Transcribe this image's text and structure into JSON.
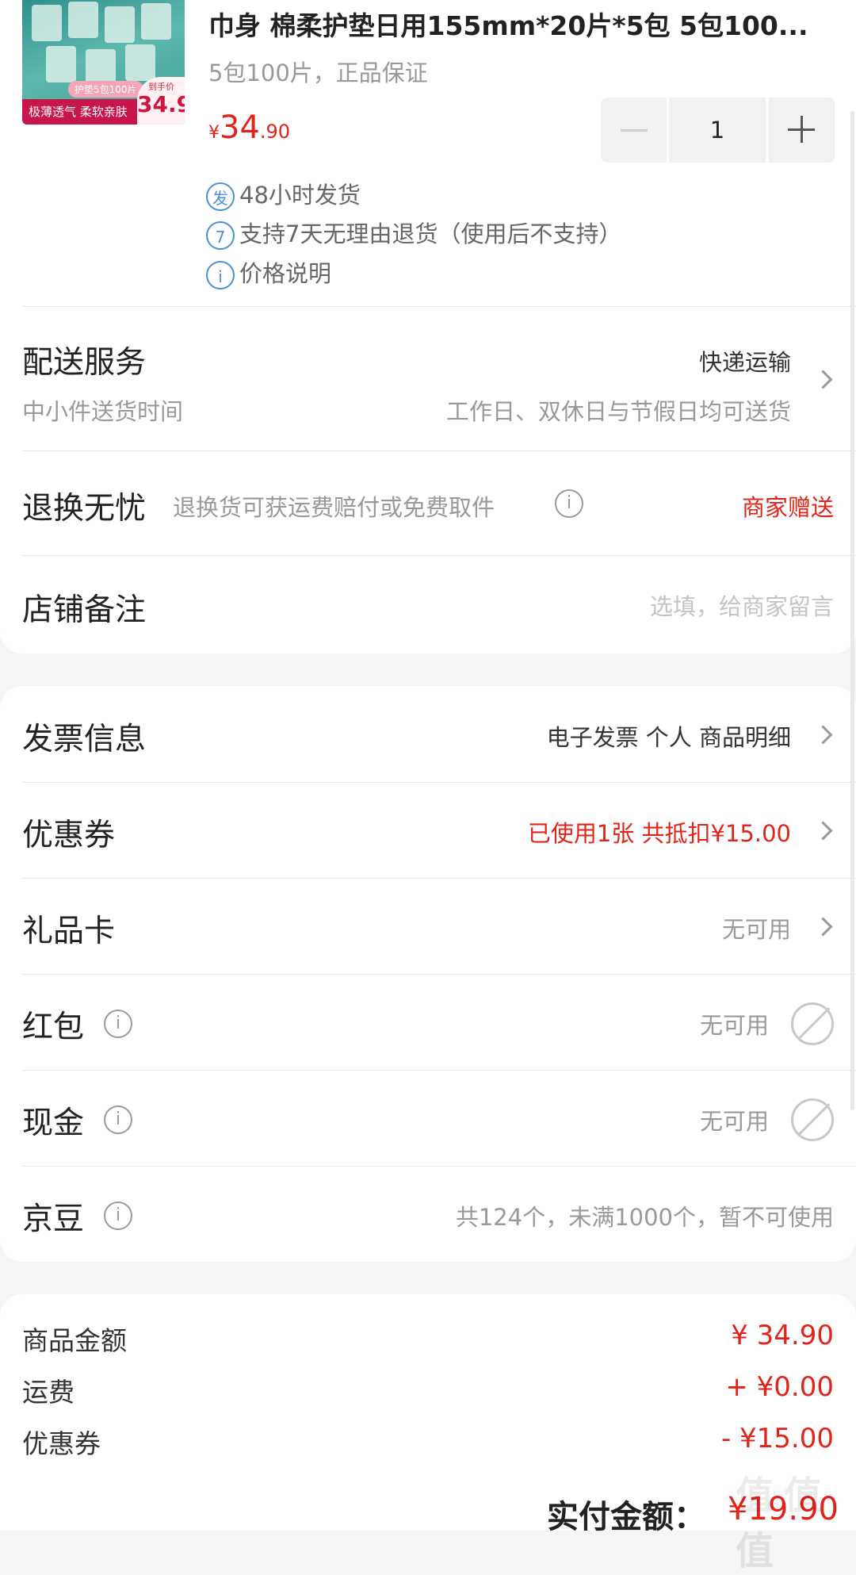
{
  "product": {
    "title": "巾身 棉柔护垫日用155mm*20片*5包 5包100...",
    "subtitle": "5包100片，正品保证",
    "price_currency": "¥",
    "price_int": "34",
    "price_dec": ".90",
    "quantity": "1",
    "image_bar_text": "极薄透气 柔软亲肤",
    "image_pill_text": "护垫5包100片",
    "image_tag_text": "到手价",
    "image_tag_price": "34.9",
    "services": [
      {
        "icon_text": "发",
        "icon": "ship-icon",
        "text": "48小时发货"
      },
      {
        "icon_text": "7",
        "icon": "seven-day-return-icon",
        "text": "支持7天无理由退货（使用后不支持）"
      },
      {
        "icon_text": "i",
        "icon": "info-icon",
        "text": "价格说明"
      }
    ]
  },
  "delivery": {
    "label": "配送服务",
    "method": "快递运输",
    "sub_label": "中小件送货时间",
    "sub_value": "工作日、双休日与节假日均可送货"
  },
  "return_worry_free": {
    "label": "退换无忧",
    "desc": "退换货可获运费赔付或免费取件",
    "value": "商家赠送"
  },
  "store_note": {
    "label": "店铺备注",
    "placeholder": "选填，给商家留言"
  },
  "payment_rows": [
    {
      "label": "发票信息",
      "value": "电子发票 个人 商品明细"
    },
    {
      "label": "优惠券",
      "value": "已使用1张 共抵扣¥15.00"
    },
    {
      "label": "礼品卡",
      "value": "无可用"
    },
    {
      "label": "红包",
      "value": "无可用"
    },
    {
      "label": "现金",
      "value": "无可用"
    },
    {
      "label": "京豆",
      "value": "共124个，未满1000个，暂不可使用"
    }
  ],
  "summary": [
    {
      "label": "商品金额",
      "value": "¥ 34.90"
    },
    {
      "label": "运费",
      "value": "+ ¥0.00"
    },
    {
      "label": "优惠券",
      "value": "- ¥15.00"
    }
  ],
  "total": {
    "label": "实付金额：",
    "value": "¥19.90"
  },
  "watermark": "值 值 值",
  "colors": {
    "accent_red": "#e2231a",
    "service_blue": "#4a90d9",
    "background": "#f5f5f5"
  }
}
